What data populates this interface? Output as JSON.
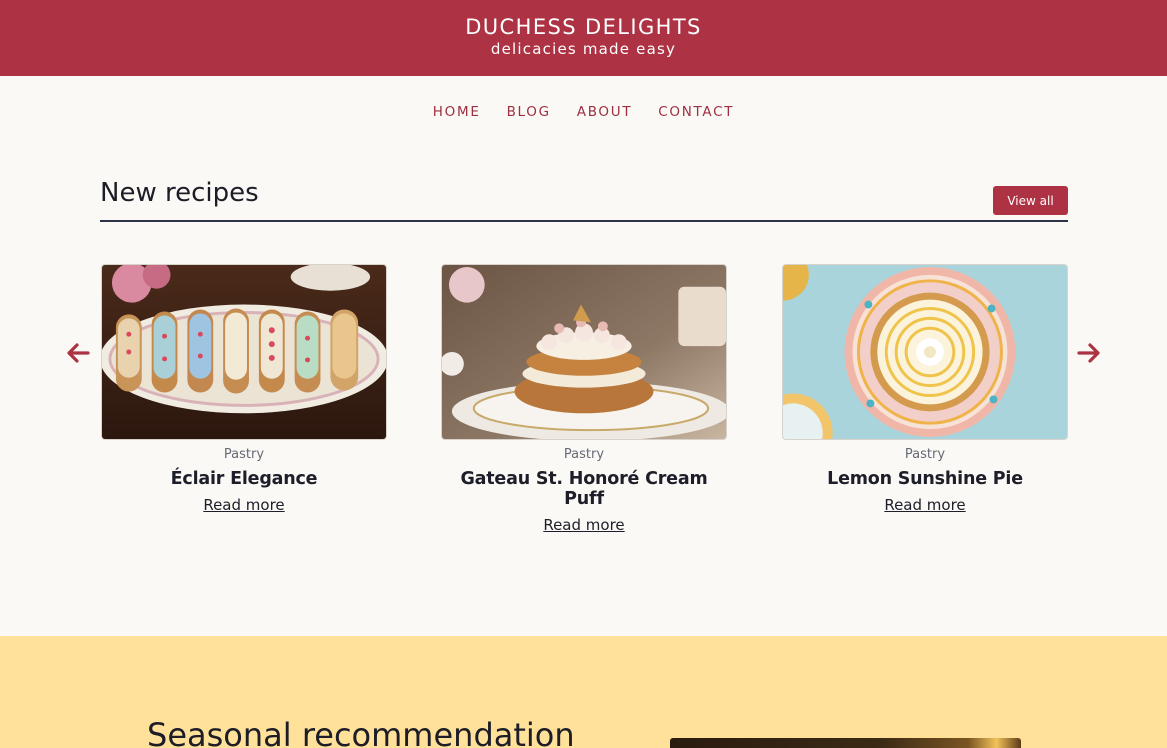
{
  "site": {
    "title": "DUCHESS DELIGHTS",
    "tagline": "delicacies made easy"
  },
  "nav": {
    "items": [
      "HOME",
      "BLOG",
      "ABOUT",
      "CONTACT"
    ]
  },
  "new_recipes": {
    "heading": "New recipes",
    "view_all_label": "View all",
    "prev_icon": "arrow-left-icon",
    "next_icon": "arrow-right-icon",
    "cards": [
      {
        "category": "Pastry",
        "title": "Éclair Elegance",
        "link_label": "Read more",
        "image": "eclairs-photo"
      },
      {
        "category": "Pastry",
        "title": "Gateau St. Honoré Cream Puff",
        "link_label": "Read more",
        "image": "cream-puff-photo"
      },
      {
        "category": "Pastry",
        "title": "Lemon Sunshine Pie",
        "link_label": "Read more",
        "image": "lemon-pie-photo"
      }
    ]
  },
  "seasonal": {
    "heading": "Seasonal recommendation"
  },
  "colors": {
    "brand": "#ad3344",
    "background": "#fbf9f5",
    "seasonal_background": "#ffe19a",
    "text": "#1d1d27"
  }
}
